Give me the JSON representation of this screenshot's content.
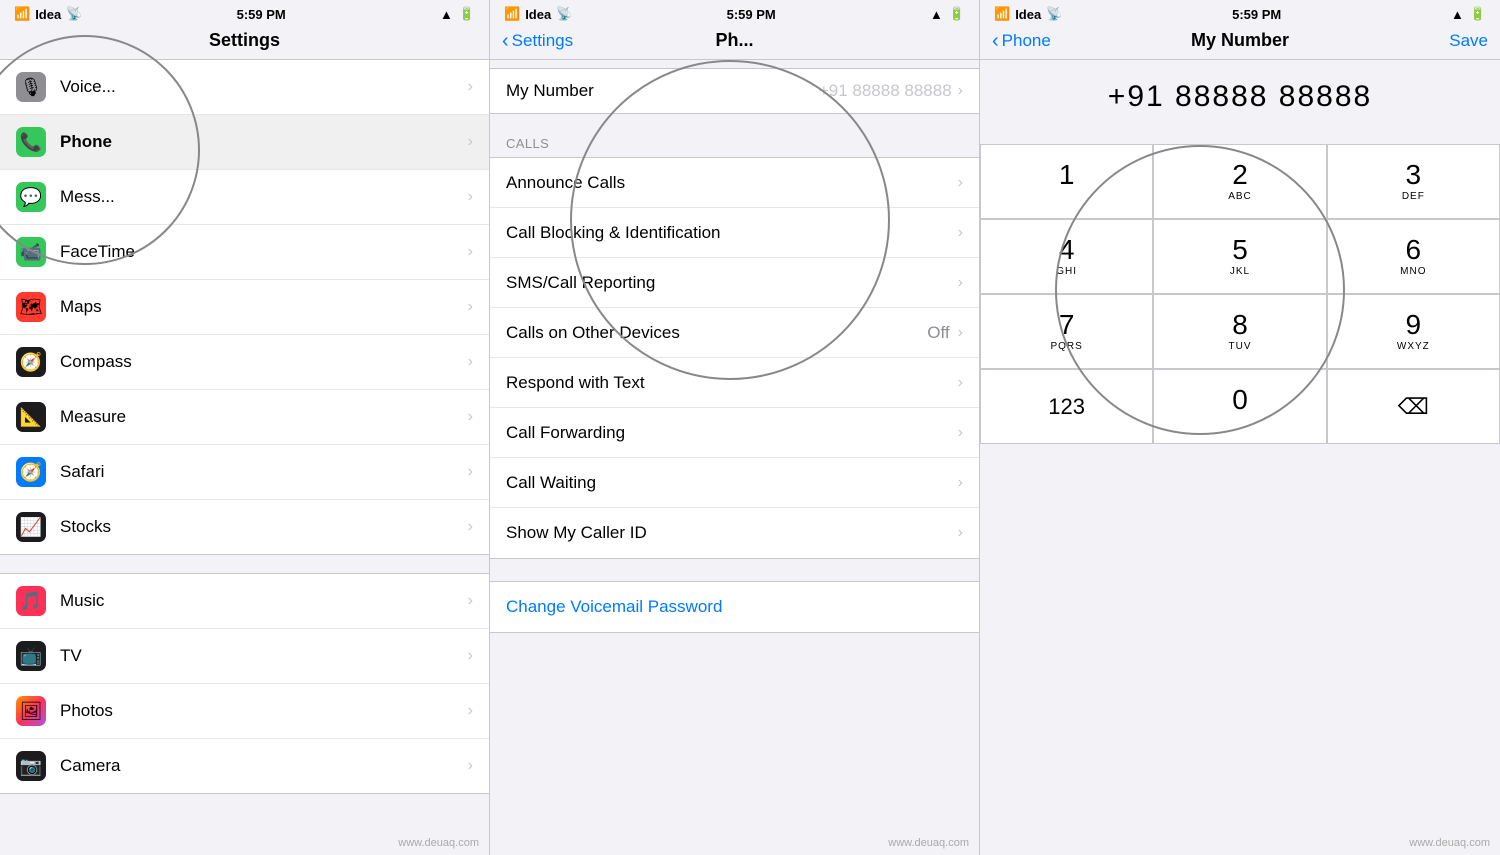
{
  "panels": {
    "left": {
      "status": {
        "carrier": "Idea",
        "wifi": "WiFi",
        "time": "5:59 PM",
        "location": "▲",
        "battery": "Battery"
      },
      "nav_title": "Settings",
      "rows": [
        {
          "id": "voice",
          "icon": "🎙",
          "icon_bg": "#8e8e93",
          "label": "Voice..."
        },
        {
          "id": "phone",
          "icon": "📞",
          "icon_bg": "#34c759",
          "label": "Phone"
        },
        {
          "id": "messages",
          "icon": "💬",
          "icon_bg": "#34c759",
          "label": "Mess..."
        },
        {
          "id": "facetime",
          "icon": "📹",
          "icon_bg": "#34c759",
          "label": "FaceTime"
        },
        {
          "id": "maps",
          "icon": "🗺",
          "icon_bg": "#ff3b30",
          "label": "Maps"
        },
        {
          "id": "compass",
          "icon": "🧭",
          "icon_bg": "#000",
          "label": "Compass"
        },
        {
          "id": "measure",
          "icon": "📐",
          "icon_bg": "#000",
          "label": "Measure"
        },
        {
          "id": "safari",
          "icon": "🧭",
          "icon_bg": "#007aff",
          "label": "Safari"
        },
        {
          "id": "stocks",
          "icon": "📈",
          "icon_bg": "#000",
          "label": "Stocks"
        }
      ],
      "rows2": [
        {
          "id": "music",
          "icon": "🎵",
          "icon_bg": "#fc3158",
          "label": "Music"
        },
        {
          "id": "tv",
          "icon": "📺",
          "icon_bg": "#000",
          "label": "TV"
        },
        {
          "id": "photos",
          "icon": "🖼",
          "icon_bg": "#ff9500",
          "label": "Photos"
        },
        {
          "id": "camera",
          "icon": "📷",
          "icon_bg": "#000",
          "label": "Camera"
        }
      ]
    },
    "mid": {
      "status": {
        "carrier": "Idea",
        "wifi": "WiFi",
        "time": "5:59 PM",
        "location": "▲",
        "battery": "Battery"
      },
      "nav_back": "Settings",
      "nav_title": "Ph...",
      "my_number_label": "My Number",
      "my_number_value": "+91 88888 88888",
      "calls_section": "CALLS",
      "call_rows": [
        {
          "id": "announce",
          "label": "Announce Calls",
          "value": ""
        },
        {
          "id": "blocking",
          "label": "Call Blocking & Identification",
          "value": ""
        },
        {
          "id": "sms",
          "label": "SMS/Call Reporting",
          "value": ""
        },
        {
          "id": "other_devices",
          "label": "Calls on Other Devices",
          "value": "Off"
        },
        {
          "id": "respond",
          "label": "Respond with Text",
          "value": ""
        },
        {
          "id": "forwarding",
          "label": "Call Forwarding",
          "value": ""
        },
        {
          "id": "waiting",
          "label": "Call Waiting",
          "value": ""
        },
        {
          "id": "caller_id",
          "label": "Show My Caller ID",
          "value": ""
        }
      ],
      "voicemail_label": "Change Voicemail Password"
    },
    "right": {
      "status": {
        "carrier": "Idea",
        "wifi": "WiFi",
        "time": "5:59 PM",
        "location": "▲",
        "battery": "Battery"
      },
      "nav_back": "Phone",
      "nav_title": "My Number",
      "nav_action": "Save",
      "phone_number": "+91 88888 88888",
      "dialpad": [
        {
          "digit": "1",
          "letters": ""
        },
        {
          "digit": "2",
          "letters": "ABC"
        },
        {
          "digit": "3",
          "letters": "DEF"
        },
        {
          "digit": "4",
          "letters": "GHI"
        },
        {
          "digit": "5",
          "letters": "JKL"
        },
        {
          "digit": "6",
          "letters": "MNO"
        },
        {
          "digit": "7",
          "letters": "PQRS"
        },
        {
          "digit": "8",
          "letters": "TUV"
        },
        {
          "digit": "9",
          "letters": "WXYZ"
        },
        {
          "digit": "123",
          "letters": ""
        },
        {
          "digit": "0",
          "letters": ""
        },
        {
          "digit": "⌫",
          "letters": ""
        }
      ],
      "bottom_row": [
        "123",
        "+ * #",
        "0",
        "⌫"
      ]
    }
  },
  "watermark": "www.deuaq.com"
}
